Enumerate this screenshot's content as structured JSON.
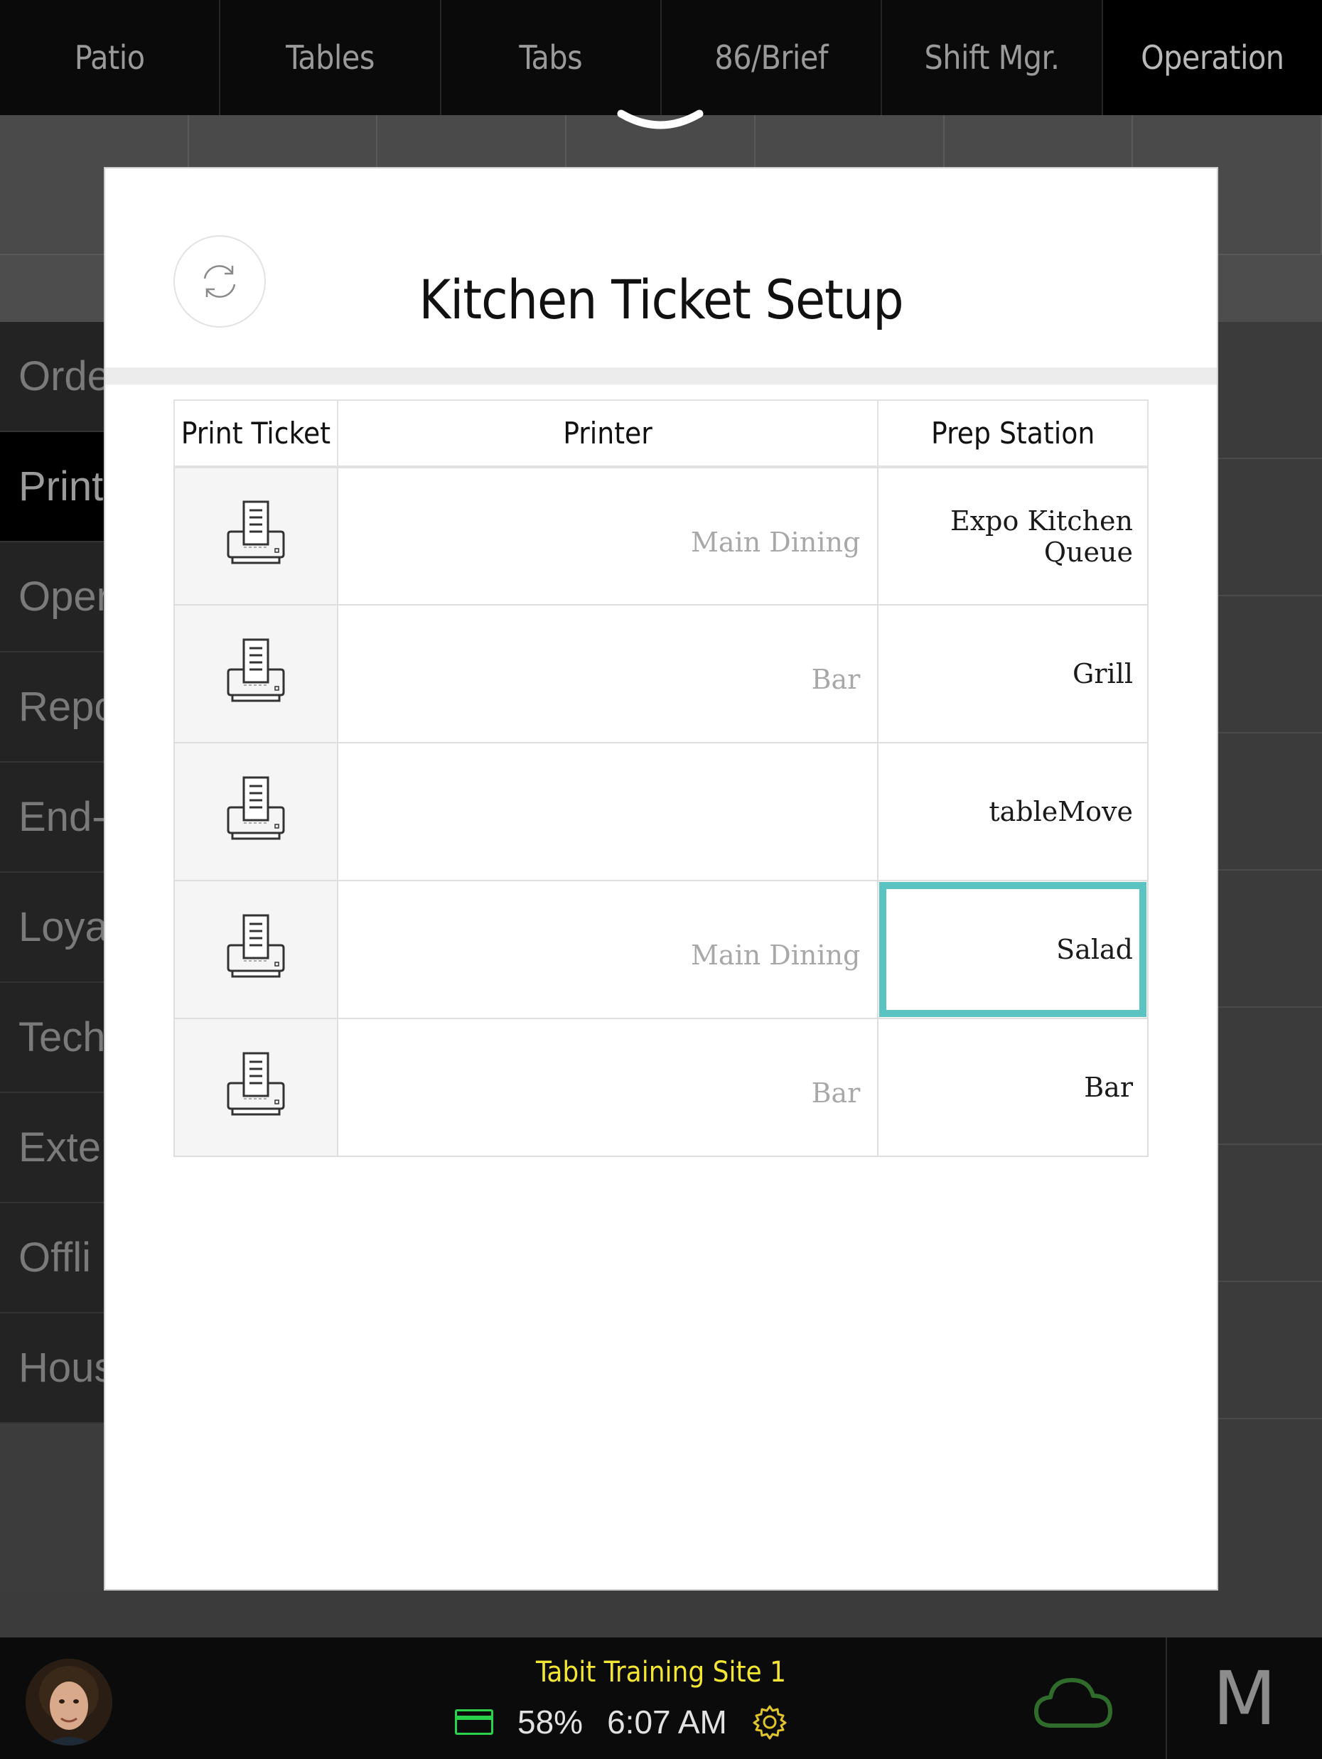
{
  "topnav": {
    "tabs": [
      {
        "label": "Patio"
      },
      {
        "label": "Tables"
      },
      {
        "label": "Tabs"
      },
      {
        "label": "86/Brief"
      },
      {
        "label": "Shift Mgr."
      },
      {
        "label": "Operation"
      }
    ],
    "active": "Operation"
  },
  "sidemenu": {
    "items": [
      {
        "label": "Orde"
      },
      {
        "label": "Print"
      },
      {
        "label": "Oper"
      },
      {
        "label": "Repo"
      },
      {
        "label": "End-"
      },
      {
        "label": "Loya"
      },
      {
        "label": "Tech"
      },
      {
        "label": "Exter"
      },
      {
        "label": "Offli"
      },
      {
        "label": "Hous"
      }
    ],
    "active_index": 1
  },
  "modal": {
    "title": "Kitchen Ticket Setup",
    "refresh_icon": "refresh-icon",
    "columns": {
      "print_ticket": "Print Ticket",
      "printer": "Printer",
      "prep_station": "Prep Station"
    },
    "rows": [
      {
        "printer": "Main Dining",
        "station": "Expo Kitchen Queue"
      },
      {
        "printer": "Bar",
        "station": "Grill"
      },
      {
        "printer": "",
        "station": "tableMove"
      },
      {
        "printer": "Main Dining",
        "station": "Salad",
        "selected": true
      },
      {
        "printer": "Bar",
        "station": "Bar"
      }
    ],
    "selection_color": "#5bc4c3"
  },
  "bottombar": {
    "site_name": "Tabit Training Site 1",
    "battery": "58%",
    "time": "6:07 AM",
    "menu_letter": "M",
    "colors": {
      "site_name": "#f2e632",
      "card": "#29d24a",
      "cloud": "#2f6b2a",
      "gear": "#e0c52a"
    }
  }
}
